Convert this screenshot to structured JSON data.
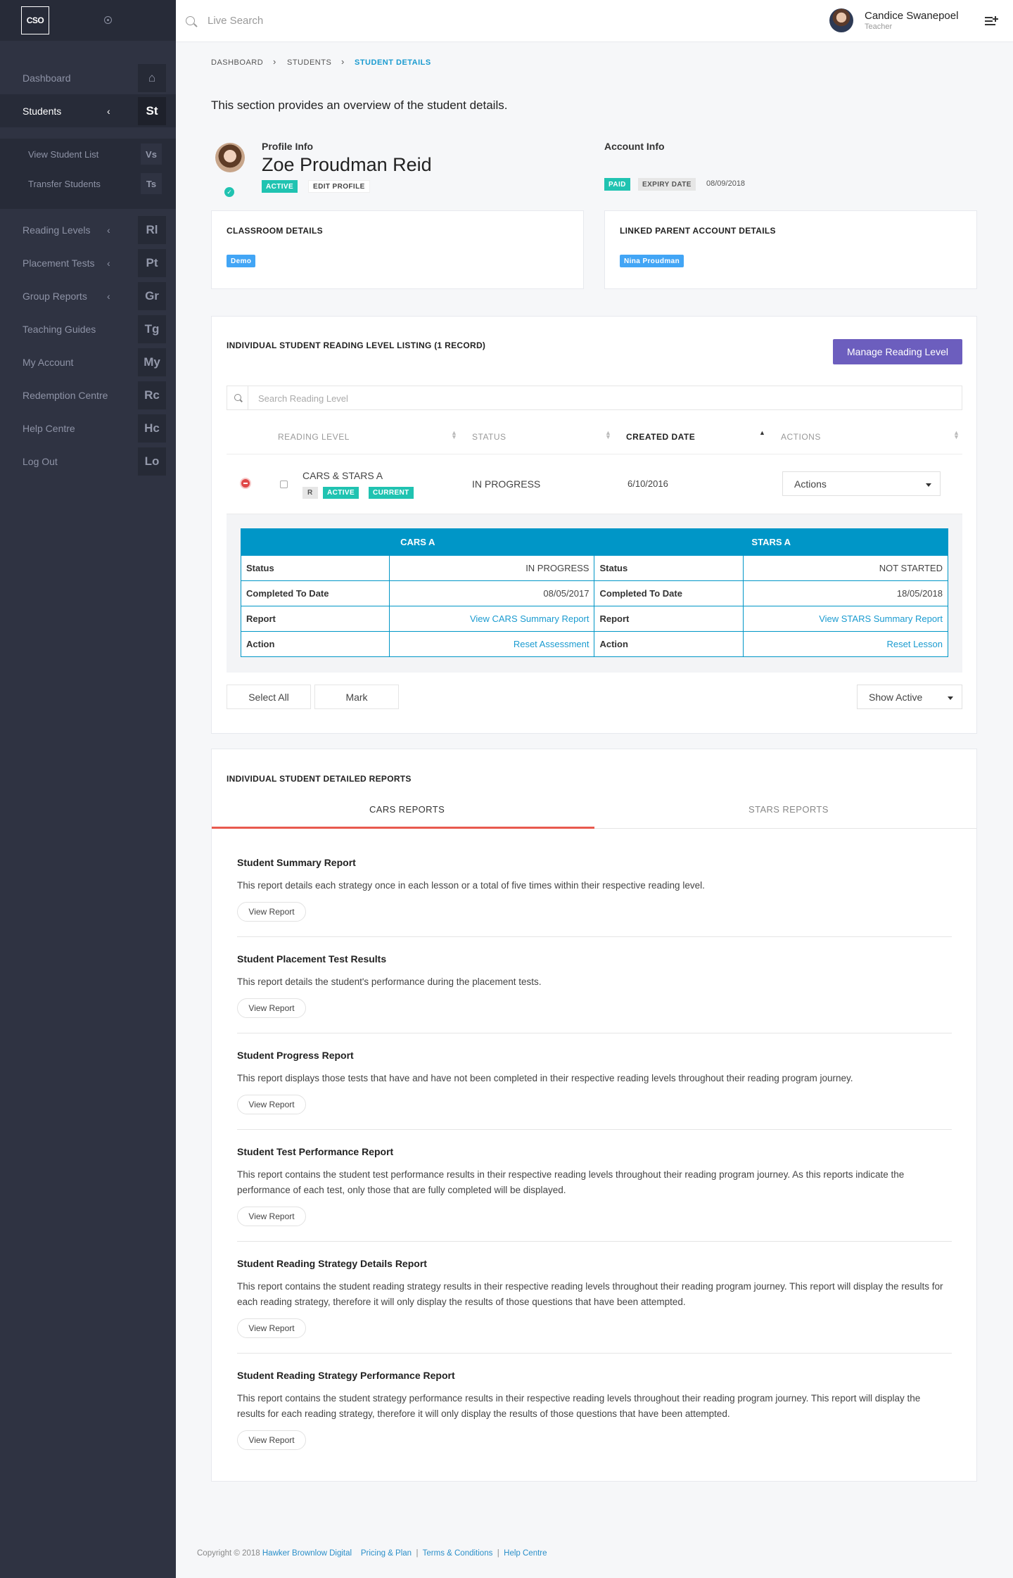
{
  "sidebar": {
    "logo": "CSO",
    "nav": [
      {
        "label": "Dashboard",
        "abbr": "⌂"
      },
      {
        "label": "Students",
        "abbr": "St"
      },
      {
        "label": "Reading Levels",
        "abbr": "Rl"
      },
      {
        "label": "Placement Tests",
        "abbr": "Pt"
      },
      {
        "label": "Group Reports",
        "abbr": "Gr"
      },
      {
        "label": "Teaching Guides",
        "abbr": "Tg"
      },
      {
        "label": "My Account",
        "abbr": "My"
      },
      {
        "label": "Redemption Centre",
        "abbr": "Rc"
      },
      {
        "label": "Help Centre",
        "abbr": "Hc"
      },
      {
        "label": "Log Out",
        "abbr": "Lo"
      }
    ],
    "sub": [
      {
        "label": "View Student List",
        "abbr": "Vs"
      },
      {
        "label": "Transfer Students",
        "abbr": "Ts"
      }
    ]
  },
  "header": {
    "search_placeholder": "Live Search",
    "user_name": "Candice Swanepoel",
    "user_role": "Teacher"
  },
  "breadcrumb": [
    "DASHBOARD",
    "STUDENTS",
    "STUDENT DETAILS"
  ],
  "intro": "This section provides an overview of the student details.",
  "profile": {
    "heading": "Profile Info",
    "name": "Zoe Proudman Reid",
    "status": "ACTIVE",
    "edit": "EDIT PROFILE"
  },
  "account": {
    "heading": "Account Info",
    "paid": "PAID",
    "expiry_label": "EXPIRY DATE",
    "expiry_date": "08/09/2018"
  },
  "classroom": {
    "title": "CLASSROOM DETAILS",
    "tag": "Demo"
  },
  "parent": {
    "title": "LINKED PARENT ACCOUNT DETAILS",
    "tag": "Nina Proudman"
  },
  "listing": {
    "title": "INDIVIDUAL STUDENT READING LEVEL LISTING (1 RECORD)",
    "manage_btn": "Manage Reading Level",
    "search_placeholder": "Search Reading Level",
    "columns": [
      "READING LEVEL",
      "STATUS",
      "CREATED DATE",
      "ACTIONS"
    ],
    "row": {
      "level": "CARS & STARS A",
      "tags": [
        "R",
        "ACTIVE",
        "CURRENT"
      ],
      "status": "IN PROGRESS",
      "created": "6/10/2016",
      "actions": "Actions"
    },
    "detail": {
      "cars_title": "CARS A",
      "stars_title": "STARS A",
      "rows": [
        {
          "k1": "Status",
          "v1": "IN PROGRESS",
          "k2": "Status",
          "v2": "NOT STARTED"
        },
        {
          "k1": "Completed To Date",
          "v1": "08/05/2017",
          "k2": "Completed To Date",
          "v2": "18/05/2018"
        },
        {
          "k1": "Report",
          "v1": "View CARS Summary Report",
          "k2": "Report",
          "v2": "View STARS Summary Report"
        },
        {
          "k1": "Action",
          "v1": "Reset Assessment",
          "k2": "Action",
          "v2": "Reset Lesson"
        }
      ]
    },
    "select_all": "Select All",
    "mark": "Mark",
    "show_active": "Show Active"
  },
  "reports": {
    "title": "INDIVIDUAL STUDENT DETAILED REPORTS",
    "tabs": [
      "CARS REPORTS",
      "STARS REPORTS"
    ],
    "button": "View Report",
    "items": [
      {
        "title": "Student Summary Report",
        "desc": "This report details each strategy once in each lesson or a total of five times within their respective reading level."
      },
      {
        "title": "Student Placement Test Results",
        "desc": "This report details the student's performance during the placement tests."
      },
      {
        "title": "Student Progress Report",
        "desc": "This report displays those tests that have and have not been completed in their respective reading levels throughout their reading program journey."
      },
      {
        "title": "Student Test Performance Report",
        "desc": "This report contains the student test performance results in their respective reading levels throughout their reading program journey. As this reports indicate the performance of each test, only those that are fully completed will be displayed."
      },
      {
        "title": "Student Reading Strategy Details Report",
        "desc": "This report contains the student reading strategy results in their respective reading levels throughout their reading program journey. This report will display the results for each reading strategy, therefore it will only display the results of those questions that have been attempted."
      },
      {
        "title": "Student Reading Strategy Performance Report",
        "desc": "This report contains the student strategy performance results in their respective reading levels throughout their reading program journey. This report will display the results for each reading strategy, therefore it will only display the results of those questions that have been attempted."
      }
    ]
  },
  "footer": {
    "copyright": "Copyright © 2018",
    "company": "Hawker Brownlow Digital",
    "links": [
      "Pricing & Plan",
      "Terms & Conditions",
      "Help Centre"
    ]
  }
}
